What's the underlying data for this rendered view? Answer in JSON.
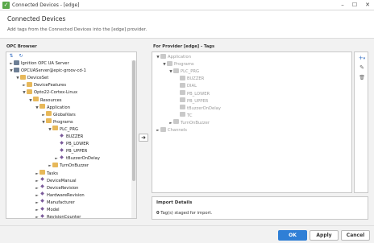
{
  "window": {
    "title": "Connected Devices - [edge]",
    "app_icon_glyph": "✓",
    "controls": {
      "minimize": "–",
      "maximize": "☐",
      "close": "✕"
    }
  },
  "header": {
    "title": "Connected Devices",
    "subtitle": "Add tags from the Connected Devices into the [edge] provider."
  },
  "opc_browser": {
    "label": "OPC Browser",
    "toolbar_icons": [
      "sort-icon",
      "refresh-icon"
    ],
    "tree": [
      {
        "label": "Ignition OPC UA Server",
        "icon": "server",
        "toggle": "►",
        "depth": 0
      },
      {
        "label": "OPCUAServer@epic-groov-cd-1",
        "icon": "server",
        "toggle": "▼",
        "depth": 0
      },
      {
        "label": "DeviceSet",
        "icon": "folder",
        "toggle": "▼",
        "depth": 1
      },
      {
        "label": "DeviceFeatures",
        "icon": "folder",
        "toggle": "►",
        "depth": 2
      },
      {
        "label": "Opto22-Cortex-Linux",
        "icon": "folder",
        "toggle": "▼",
        "depth": 2
      },
      {
        "label": "Resources",
        "icon": "folder",
        "toggle": "▼",
        "depth": 3
      },
      {
        "label": "Application",
        "icon": "folder",
        "toggle": "▼",
        "depth": 4
      },
      {
        "label": "GlobalVars",
        "icon": "folder",
        "toggle": "►",
        "depth": 5
      },
      {
        "label": "Programs",
        "icon": "folder",
        "toggle": "▼",
        "depth": 5
      },
      {
        "label": "PLC_PRG",
        "icon": "folder",
        "toggle": "▼",
        "depth": 6
      },
      {
        "label": "BUZZER",
        "icon": "tag",
        "toggle": "",
        "depth": 7
      },
      {
        "label": "PB_LOWER",
        "icon": "tag",
        "toggle": "",
        "depth": 7
      },
      {
        "label": "PB_UPPER",
        "icon": "tag",
        "toggle": "",
        "depth": 7
      },
      {
        "label": "tBuzzerOnDelay",
        "icon": "tag",
        "toggle": "►",
        "depth": 7
      },
      {
        "label": "TurnOnBuzzer",
        "icon": "folder",
        "toggle": "►",
        "depth": 6
      },
      {
        "label": "Tasks",
        "icon": "folder",
        "toggle": "►",
        "depth": 4
      },
      {
        "label": "DeviceManual",
        "icon": "tag",
        "toggle": "►",
        "depth": 4
      },
      {
        "label": "DeviceRevision",
        "icon": "tag",
        "toggle": "►",
        "depth": 4
      },
      {
        "label": "HardwareRevision",
        "icon": "tag",
        "toggle": "►",
        "depth": 4
      },
      {
        "label": "Manufacturer",
        "icon": "tag",
        "toggle": "►",
        "depth": 4
      },
      {
        "label": "Model",
        "icon": "tag",
        "toggle": "►",
        "depth": 4
      },
      {
        "label": "RevisionCounter",
        "icon": "tag",
        "toggle": "►",
        "depth": 4
      },
      {
        "label": "SerialNumber",
        "icon": "tag",
        "toggle": "►",
        "depth": 4
      },
      {
        "label": "SoftwareRevision",
        "icon": "tag",
        "toggle": "►",
        "depth": 4
      }
    ]
  },
  "transfer_button": {
    "glyph": "➜"
  },
  "provider": {
    "label": "For Provider [edge] - Tags",
    "tree": [
      {
        "label": "Application",
        "icon": "folder",
        "toggle": "▼",
        "depth": 0
      },
      {
        "label": "Programs",
        "icon": "folder",
        "toggle": "▼",
        "depth": 1
      },
      {
        "label": "PLC_PRG",
        "icon": "folder",
        "toggle": "▼",
        "depth": 2
      },
      {
        "label": "BUZZER",
        "icon": "tag",
        "toggle": "",
        "depth": 3
      },
      {
        "label": "DIAL",
        "icon": "tag",
        "toggle": "",
        "depth": 3
      },
      {
        "label": "PB_LOWER",
        "icon": "tag",
        "toggle": "",
        "depth": 3
      },
      {
        "label": "PB_UPPER",
        "icon": "tag",
        "toggle": "",
        "depth": 3
      },
      {
        "label": "tBuzzerOnDelay",
        "icon": "tag",
        "toggle": "",
        "depth": 3
      },
      {
        "label": "TC",
        "icon": "tag",
        "toggle": "",
        "depth": 3
      },
      {
        "label": "TurnOnBuzzer",
        "icon": "folder",
        "toggle": "►",
        "depth": 2
      },
      {
        "label": "Channels",
        "icon": "folder",
        "toggle": "►",
        "depth": 0
      }
    ],
    "tools": {
      "add": "+",
      "add_caret": "▾",
      "edit": "✎",
      "delete": "🗑"
    }
  },
  "import_details": {
    "title": "Import Details",
    "count": "0",
    "message": "Tag(s) staged for import."
  },
  "footer": {
    "ok_label": "OK",
    "apply_label": "Apply",
    "cancel_label": "Cancel"
  },
  "colors": {
    "primary_button": "#2f7fd6",
    "folder": "#e7b85a",
    "tag": "#7a5a9a",
    "disabled_text": "#9a9a9a"
  }
}
